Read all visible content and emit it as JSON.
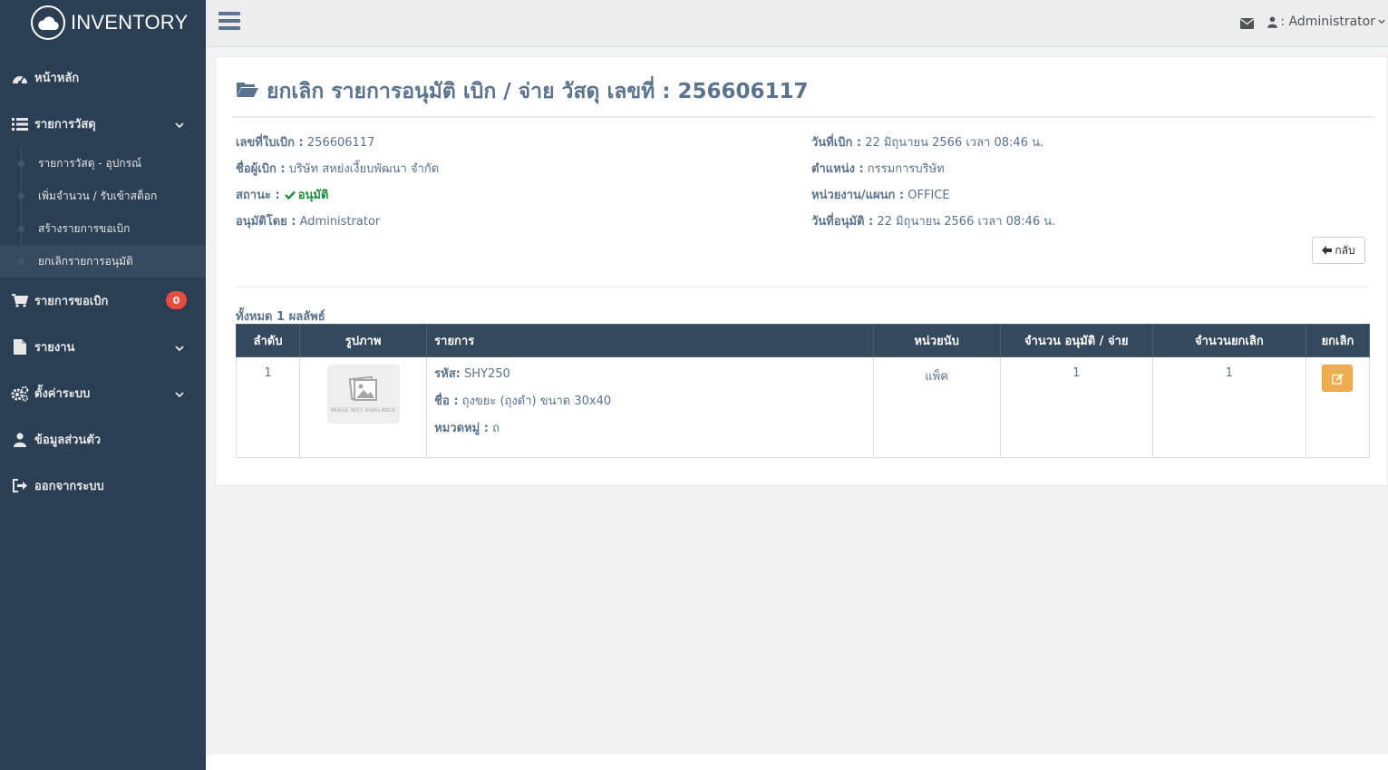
{
  "brand": {
    "name": "INVENTORY",
    "icon": "cloud-icon"
  },
  "sidebar": {
    "items": [
      {
        "label": "หน้าหลัก",
        "icon": "dashboard-icon"
      },
      {
        "label": "รายการวัสดุ",
        "icon": "list-icon",
        "chevron": true
      },
      {
        "label": "รายการขอเบิก",
        "icon": "cart-icon",
        "badge": "0"
      },
      {
        "label": "รายงาน",
        "icon": "file-icon",
        "chevron": true
      },
      {
        "label": "ตั้งค่าระบบ",
        "icon": "gears-icon",
        "chevron": true
      },
      {
        "label": "ข้อมูลส่วนตัว",
        "icon": "user-icon"
      },
      {
        "label": "ออกจากระบบ",
        "icon": "sign-out-icon"
      }
    ],
    "submenu": [
      {
        "label": "รายการวัสดุ - อุปกรณ์"
      },
      {
        "label": "เพิ่มจำนวน / รับเข้าสต็อก"
      },
      {
        "label": "สร้างรายการขอเบิก"
      },
      {
        "label": "ยกเลิกรายการอนุมัติ",
        "active": true
      }
    ]
  },
  "topnav": {
    "user": ": Administrator"
  },
  "page": {
    "title": "ยกเลิก รายการอนุมัติ เบิก / จ่าย วัสดุ เลขที่ : 256606117",
    "info_left": {
      "doc_no_label": "เลขที่ใบเบิก :",
      "doc_no": "256606117",
      "requester_label": "ชื่อผู้เบิก :",
      "requester": "บริษัท สหย่งเงี้ยบพัฒนา จำกัด",
      "status_label": "สถานะ :",
      "status": "อนุมัติ",
      "approver_label": "อนุมัติโดย :",
      "approver": "Administrator"
    },
    "info_right": {
      "request_date_label": "วันที่เบิก :",
      "request_date": "22 มิถุนายน 2566 เวลา 08:46 น.",
      "position_label": "ตำแหน่ง :",
      "position": "กรรมการบริษัท",
      "department_label": "หน่วยงาน/แผนก :",
      "department": "OFFICE",
      "approve_date_label": "วันที่อนุมัติ :",
      "approve_date": "22 มิถุนายน 2566 เวลา 08:46 น."
    },
    "back_label": "กลับ",
    "result_count": "ทั้งหมด 1 ผลลัพธ์"
  },
  "table": {
    "headers": [
      "ลำดับ",
      "รูปภาพ",
      "รายการ",
      "หน่วยนับ",
      "จำนวน อนุมัติ / จ่าย",
      "จำนวนยกเลิก",
      "ยกเลิก"
    ],
    "rows": [
      {
        "no": "1",
        "image_caption": "IMAGE NOT AVAILABLE",
        "code_label": "รหัส:",
        "code": "SHY250",
        "name_label": "ชื่อ :",
        "name": "ถุงขยะ (ถุงดำ) ขนาด 30x40",
        "category_label": "หมวดหมู่ :",
        "category": "ถ",
        "unit": "แพ็ค",
        "approved_qty": "1",
        "cancel_qty": "1"
      }
    ]
  },
  "colors": {
    "sidebar": "#2a3f54",
    "table_header": "#34495e",
    "badge": "#e74c3c",
    "edit_button": "#f0ad4e",
    "status_ok": "#1a8f3c"
  }
}
